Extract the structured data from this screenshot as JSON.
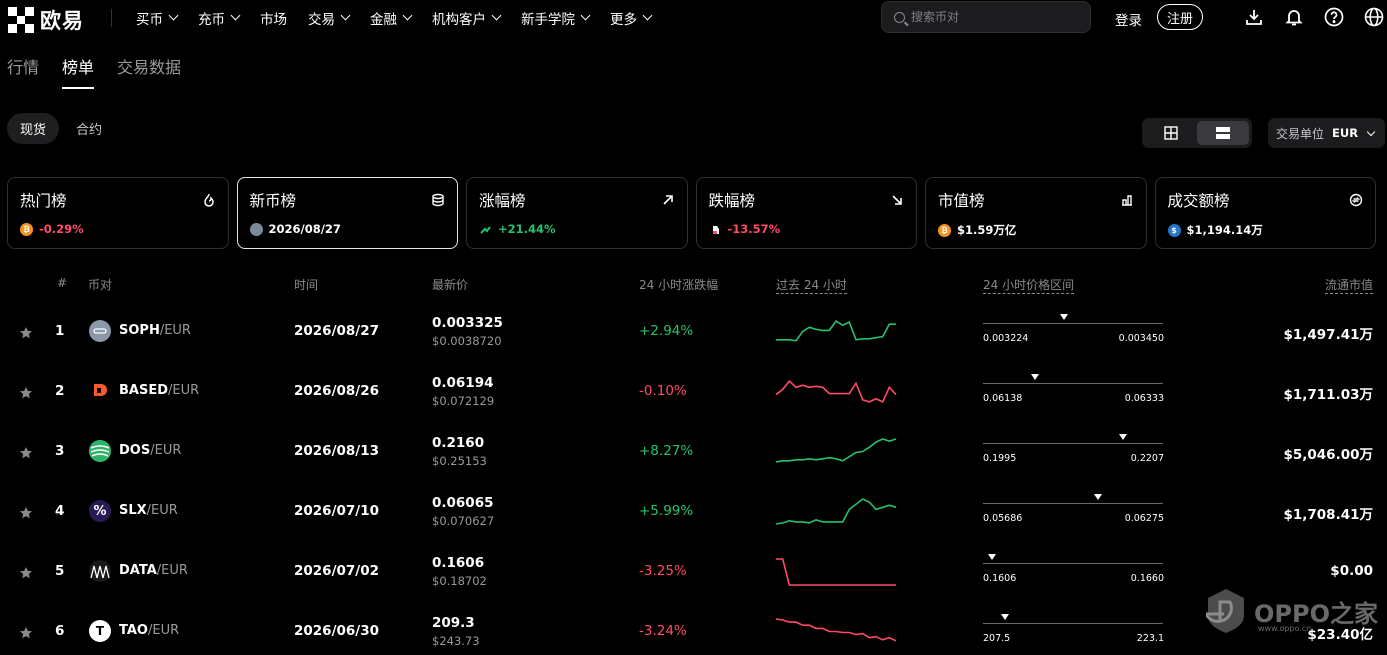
{
  "nav": {
    "brand": "欧易",
    "items": [
      {
        "label": "买币",
        "dropdown": true
      },
      {
        "label": "充币",
        "dropdown": true
      },
      {
        "label": "市场",
        "dropdown": false
      },
      {
        "label": "交易",
        "dropdown": true
      },
      {
        "label": "金融",
        "dropdown": true
      },
      {
        "label": "机构客户",
        "dropdown": true
      },
      {
        "label": "新手学院",
        "dropdown": true
      },
      {
        "label": "更多",
        "dropdown": true
      }
    ],
    "search_placeholder": "搜索币对",
    "login": "登录",
    "register": "注册",
    "icons": [
      "download-icon",
      "bell-icon",
      "help-icon",
      "globe-icon"
    ]
  },
  "tabs": [
    "行情",
    "榜单",
    "交易数据"
  ],
  "active_tab": 1,
  "market_types": [
    "现货",
    "合约"
  ],
  "active_market_type": 0,
  "unit": {
    "label": "交易单位",
    "value": "EUR"
  },
  "cards": [
    {
      "title": "热门榜",
      "icon": "flame-icon",
      "coin": "bitcoin",
      "coin_color": "#f7931a",
      "value": "-0.29%",
      "tone": "neg"
    },
    {
      "title": "新币榜",
      "icon": "coins-stack-icon",
      "coin": "soph",
      "coin_color": "#7b8a99",
      "value": "2026/08/27",
      "tone": "plain"
    },
    {
      "title": "涨幅榜",
      "icon": "arrow-up-right-icon",
      "coin": "gainer",
      "coin_color": "#25c26e",
      "value": "+21.44%",
      "tone": "pos"
    },
    {
      "title": "跌幅榜",
      "icon": "arrow-down-right-icon",
      "coin": "loser",
      "coin_color": "#ffffff",
      "value": "-13.57%",
      "tone": "neg"
    },
    {
      "title": "市值榜",
      "icon": "bar-chart-icon",
      "coin": "bitcoin",
      "coin_color": "#f7931a",
      "value": "$1.59万亿",
      "tone": "plain"
    },
    {
      "title": "成交额榜",
      "icon": "swap-icon",
      "coin": "usdc",
      "coin_color": "#2775ca",
      "value": "$1,194.14万",
      "tone": "plain"
    }
  ],
  "active_card": 1,
  "table": {
    "headers": {
      "rank": "#",
      "pair": "币对",
      "time": "时间",
      "price": "最新价",
      "change": "24 小时涨跌幅",
      "trend": "过去 24 小时",
      "range": "24 小时价格区间",
      "mcap": "流通市值"
    },
    "rows": [
      {
        "rank": "1",
        "base": "SOPH",
        "quote": "/EUR",
        "date": "2026/08/27",
        "price": "0.003325",
        "price_usd": "$0.0038720",
        "change": "+2.94%",
        "tone": "pos",
        "low": "0.003224",
        "high": "0.003450",
        "position": 0.45,
        "mcap": "$1,497.41万",
        "icon_color": "#8b98a8",
        "icon_text": "",
        "spark": [
          20,
          20,
          20,
          21,
          12,
          8,
          10,
          11,
          11,
          2,
          6,
          3,
          20,
          19,
          19,
          18,
          17,
          5,
          5
        ]
      },
      {
        "rank": "2",
        "base": "BASED",
        "quote": "/EUR",
        "date": "2026/08/26",
        "price": "0.06194",
        "price_usd": "$0.072129",
        "change": "-0.10%",
        "tone": "neg",
        "low": "0.06138",
        "high": "0.06333",
        "position": 0.29,
        "mcap": "$1,711.03万",
        "icon_color": "#ff5a2b",
        "icon_text": "",
        "spark": [
          15,
          10,
          2,
          8,
          6,
          8,
          7,
          8,
          14,
          14,
          14,
          14,
          4,
          20,
          22,
          19,
          22,
          8,
          15
        ]
      },
      {
        "rank": "3",
        "base": "DOS",
        "quote": "/EUR",
        "date": "2026/08/13",
        "price": "0.2160",
        "price_usd": "$0.25153",
        "change": "+8.27%",
        "tone": "pos",
        "low": "0.1995",
        "high": "0.2207",
        "position": 0.78,
        "mcap": "$5,046.00万",
        "icon_color": "#2fb36a",
        "icon_text": "",
        "spark": [
          22,
          21,
          21,
          20,
          20,
          19,
          20,
          19,
          18,
          19,
          21,
          17,
          13,
          12,
          8,
          3,
          0,
          2,
          0
        ]
      },
      {
        "rank": "4",
        "base": "SLX",
        "quote": "/EUR",
        "date": "2026/07/10",
        "price": "0.06065",
        "price_usd": "$0.070627",
        "change": "+5.99%",
        "tone": "pos",
        "low": "0.05686",
        "high": "0.06275",
        "position": 0.64,
        "mcap": "$1,708.41万",
        "icon_color": "#2a1b55",
        "icon_text": "%",
        "spark": [
          24,
          23,
          21,
          22,
          22,
          23,
          20,
          22,
          22,
          22,
          22,
          10,
          5,
          0,
          3,
          10,
          8,
          6,
          8
        ]
      },
      {
        "rank": "5",
        "base": "DATA",
        "quote": "/EUR",
        "date": "2026/07/02",
        "price": "0.1606",
        "price_usd": "$0.18702",
        "change": "-3.25%",
        "tone": "neg",
        "low": "0.1606",
        "high": "0.1660",
        "position": 0.05,
        "mcap": "$0.00",
        "icon_color": "#1a1a1a",
        "icon_text": "",
        "spark": [
          0,
          0,
          25,
          25,
          25,
          25,
          25,
          25,
          25,
          25,
          25,
          25,
          25,
          25,
          25,
          25,
          25,
          25,
          25
        ]
      },
      {
        "rank": "6",
        "base": "TAO",
        "quote": "/EUR",
        "date": "2026/06/30",
        "price": "209.3",
        "price_usd": "$243.73",
        "change": "-3.24%",
        "tone": "neg",
        "low": "207.5",
        "high": "223.1",
        "position": 0.12,
        "mcap": "$23.40亿",
        "icon_color": "#ffffff",
        "icon_text": "T",
        "spark": [
          0,
          1,
          3,
          3,
          6,
          6,
          9,
          9,
          12,
          12,
          13,
          13,
          15,
          14,
          18,
          17,
          20,
          18,
          21
        ]
      }
    ]
  },
  "watermark": {
    "text": "OPPO之家",
    "url": "www.oppo.cn"
  },
  "colors": {
    "up": "#25c26e",
    "down": "#ff4a68",
    "bg": "#000000"
  }
}
